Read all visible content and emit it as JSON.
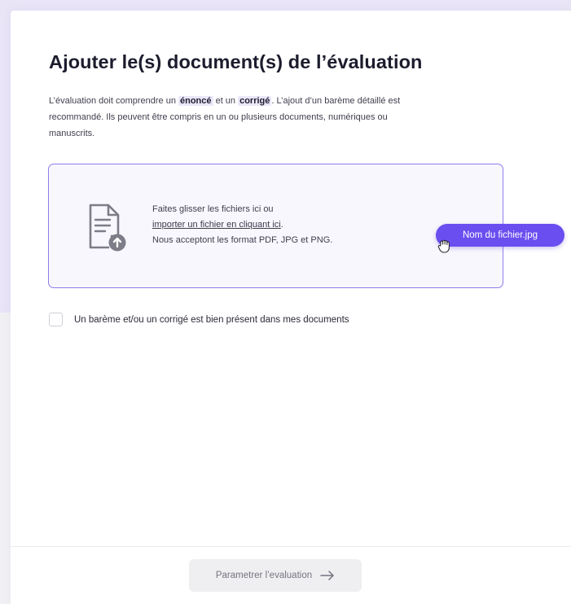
{
  "page": {
    "title": "Ajouter le(s) document(s) de l’évaluation",
    "description": {
      "part1": "L’évaluation doit comprendre un ",
      "highlight1": "énoncé",
      "part2": " et un ",
      "highlight2": "corrigé",
      "part3": ". L’ajout d’un barème détaillé est recommandé. Ils peuvent être compris en un ou plusieurs documents, numériques ou manuscrits."
    }
  },
  "dropzone": {
    "line1": "Faites glisser les fichiers ici ou",
    "link": "importer un fichier en cliquant ici",
    "link_suffix": ".",
    "line3": "Nous acceptont les format PDF, JPG et PNG.",
    "icon": "document-upload-icon"
  },
  "dragged_file": {
    "name": "Nom du fichier.jpg",
    "cursor_icon": "grab-cursor-icon"
  },
  "checkbox": {
    "label": "Un barème et/ou un corrigé est bien présent dans mes documents",
    "checked": false
  },
  "footer": {
    "next_label": "Parametrer l’evaluation",
    "next_icon": "arrow-right-icon",
    "next_disabled": true
  },
  "colors": {
    "accent": "#6b4ef0",
    "dropzone_border": "#8f7cea",
    "highlight_bg": "#ebe7fa",
    "background_top": "#e9e4f6"
  }
}
